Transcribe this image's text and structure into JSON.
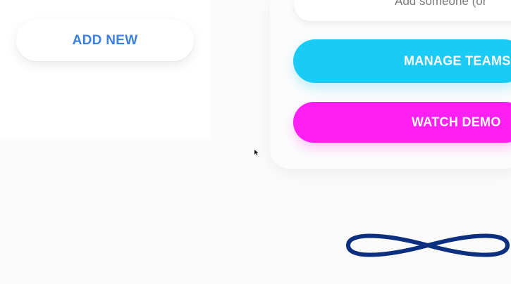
{
  "left_panel": {
    "add_new_label": "ADD NEW"
  },
  "right_panel": {
    "input_placeholder": "Add someone (or",
    "manage_teams_label": "MANAGE TEAMS",
    "watch_demo_label": "WATCH DEMO"
  },
  "colors": {
    "add_new_text": "#3a7fe0",
    "manage_teams_bg": "#19cbf5",
    "watch_demo_bg": "#ff1ff2",
    "loader_stroke": "#0d2f7f"
  },
  "icons": {
    "cursor": "mouse-cursor-icon",
    "loader": "infinity-loader-icon"
  }
}
